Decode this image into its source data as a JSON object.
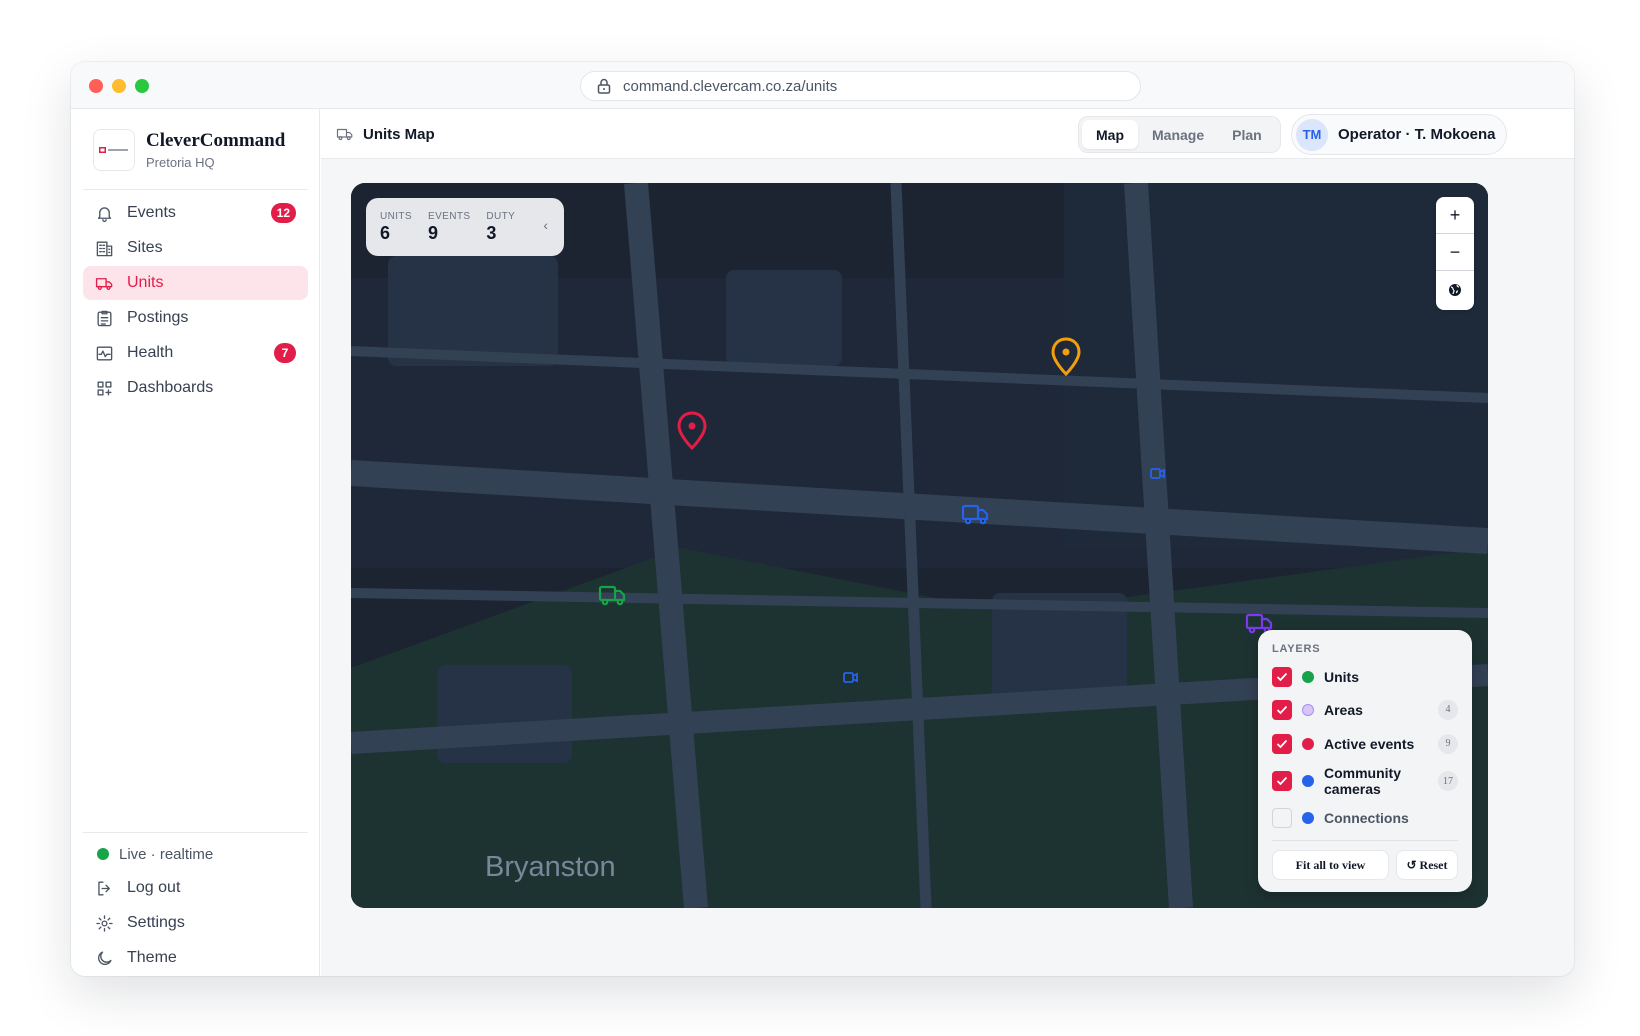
{
  "browser": {
    "url": "command.clevercam.co.za/units"
  },
  "brand": {
    "name": "CleverCommand",
    "subtitle": "Pretoria HQ"
  },
  "nav": {
    "items": [
      {
        "label": "Events",
        "badge": "12",
        "icon": "bell-icon"
      },
      {
        "label": "Sites",
        "icon": "building-icon"
      },
      {
        "label": "Units",
        "icon": "truck-icon",
        "active": true
      },
      {
        "label": "Postings",
        "icon": "clipboard-icon"
      },
      {
        "label": "Health",
        "badge": "7",
        "icon": "activity-icon"
      },
      {
        "label": "Dashboards",
        "icon": "grid-icon"
      }
    ],
    "bottom": {
      "live": "Live · realtime",
      "logout": "Log out",
      "settings": "Settings",
      "theme": "Theme"
    }
  },
  "header": {
    "title": "Units Map",
    "tabs": [
      "Map",
      "Manage",
      "Plan"
    ],
    "active_tab": "Map",
    "user": {
      "initials": "TM",
      "name": "Operator · T. Mokoena"
    }
  },
  "map": {
    "stats": [
      {
        "label": "UNITS",
        "value": "6"
      },
      {
        "label": "EVENTS",
        "value": "9"
      },
      {
        "label": "DUTY",
        "value": "3"
      }
    ],
    "zoom": {
      "in": "+",
      "out": "−"
    },
    "area_label": "Bryanston",
    "layers": {
      "title": "LAYERS",
      "items": [
        {
          "label": "Units",
          "checked": true,
          "color": "#16a34a"
        },
        {
          "label": "Areas",
          "checked": true,
          "color": "#c4a6f0",
          "count": "4"
        },
        {
          "label": "Active events",
          "checked": true,
          "color": "#e11d48",
          "count": "9"
        },
        {
          "label": "Community cameras",
          "checked": true,
          "color": "#2563eb",
          "count": "17"
        },
        {
          "label": "Connections",
          "checked": false,
          "color": "#2563eb"
        }
      ],
      "fit_label": "Fit all to view",
      "reset_label": "↺ Reset"
    }
  },
  "colors": {
    "accent": "#e11d48",
    "map_bg": "#1c2432",
    "road": "#334155",
    "park": "#1d3332"
  }
}
